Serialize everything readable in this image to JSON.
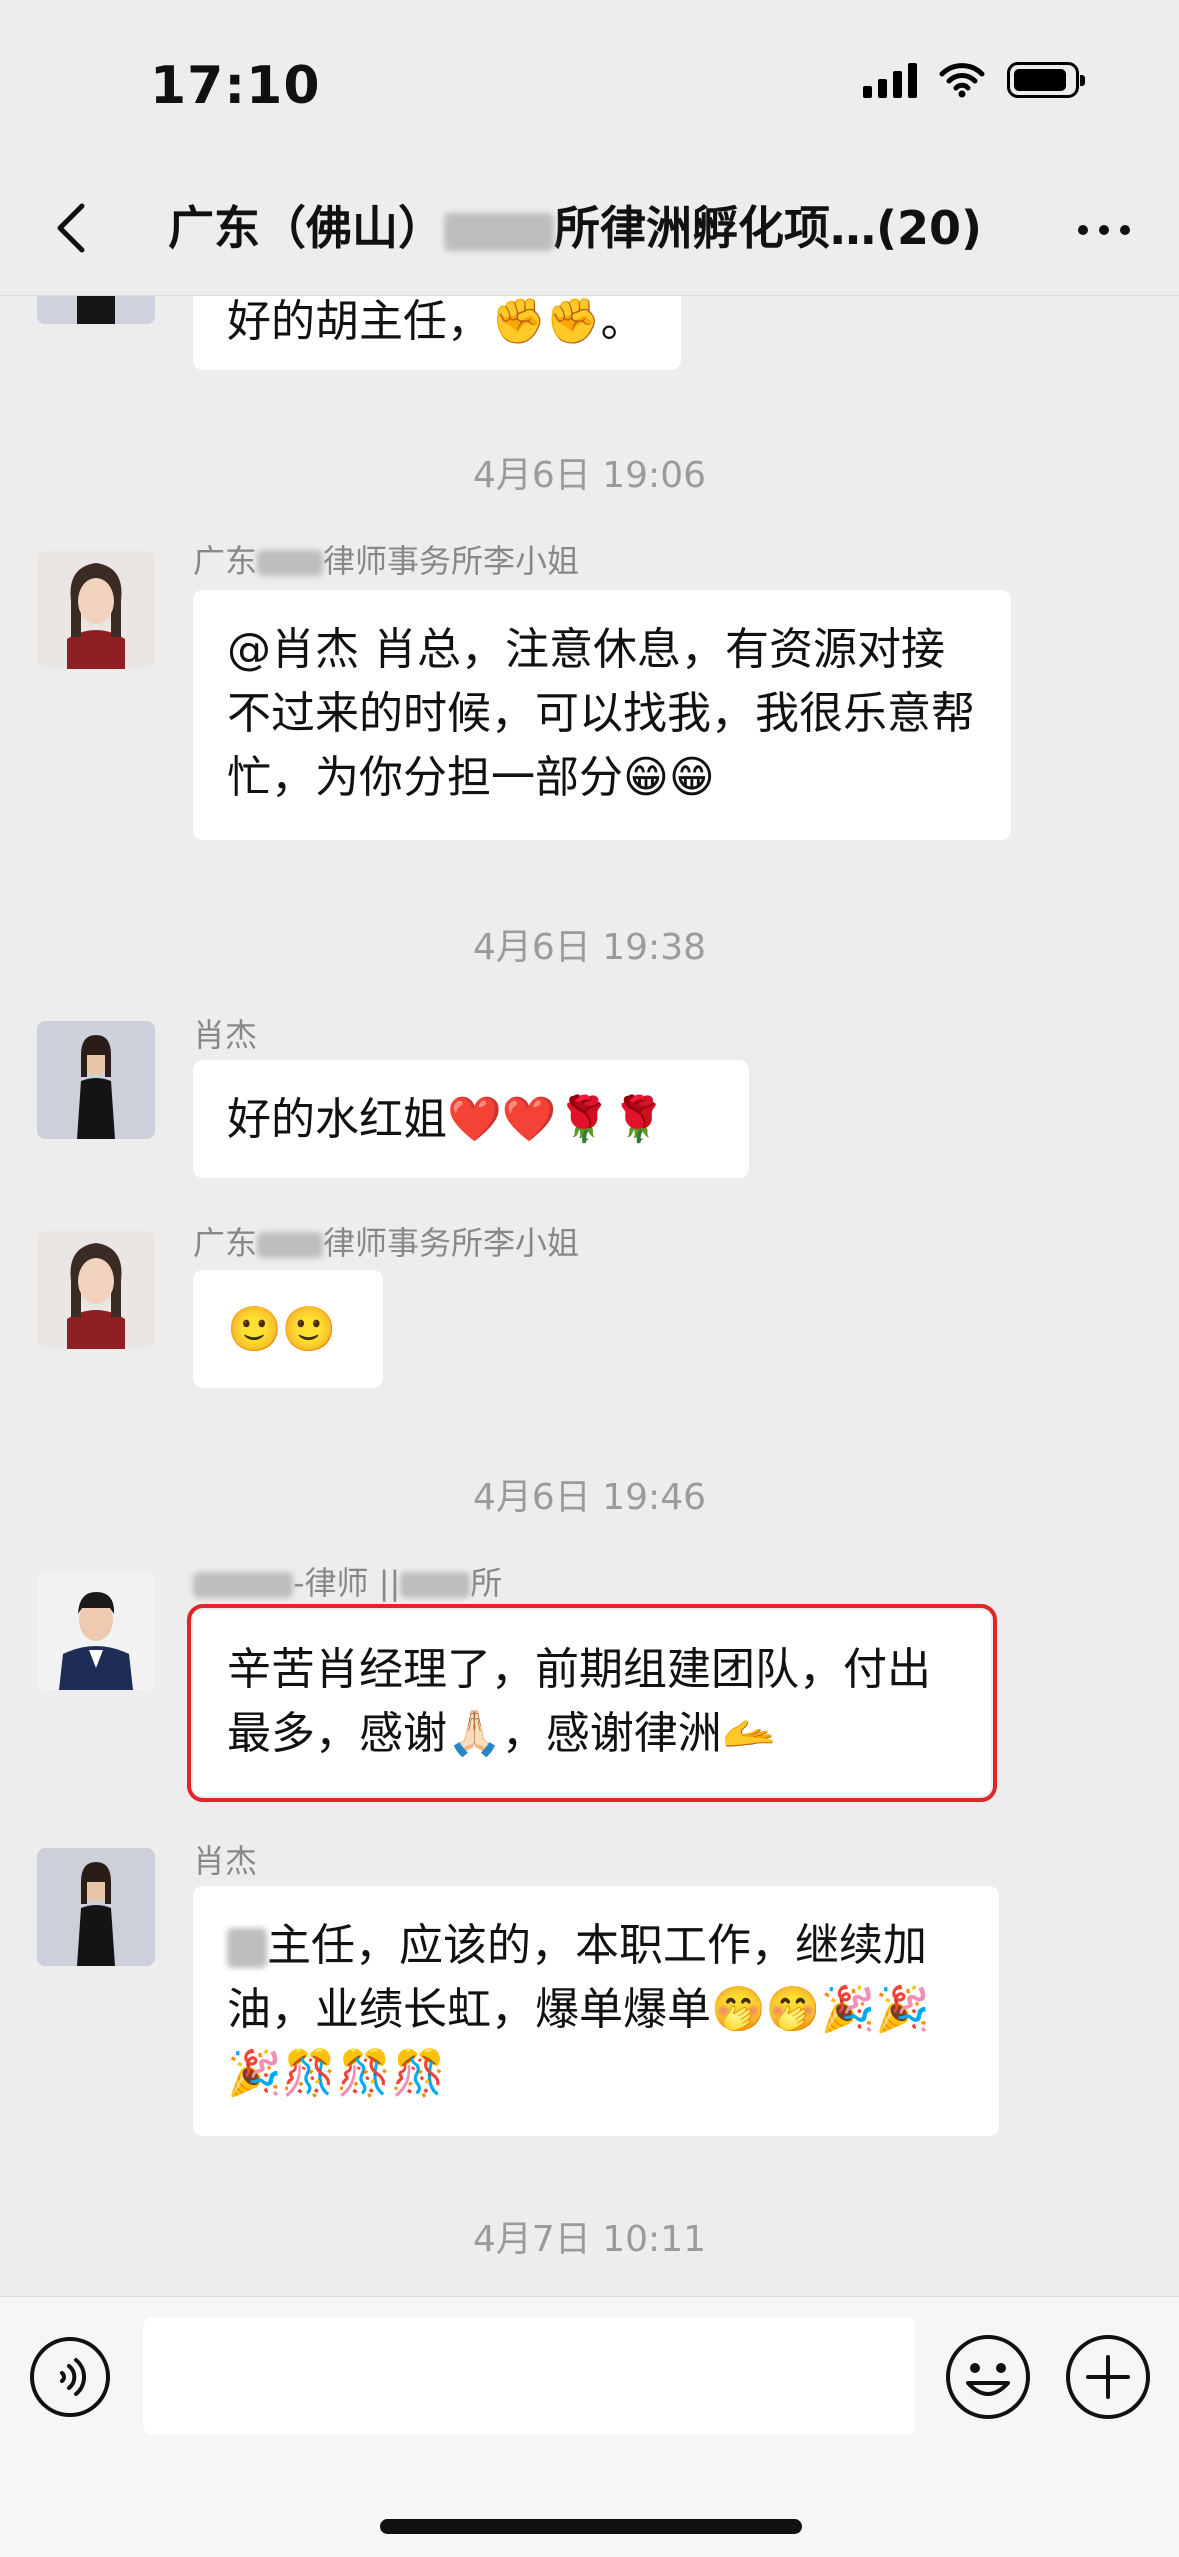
{
  "status_bar": {
    "time": "17:10"
  },
  "header": {
    "title_prefix": "广东（佛山）",
    "title_suffix": "所律洲孵化项…",
    "member_count": "(20)"
  },
  "messages": {
    "m0": {
      "text": "好的胡主任，✊✊。"
    },
    "ts1": "4月6日 19:06",
    "m1": {
      "sender_prefix": "广东",
      "sender_suffix": "律师事务所李小姐",
      "text": "@肖杰 肖总，注意休息，有资源对接不过来的时候，可以找我，我很乐意帮忙，为你分担一部分😁😁"
    },
    "ts2": "4月6日 19:38",
    "m2": {
      "sender": "肖杰",
      "text": "好的水红姐❤️❤️🌹🌹"
    },
    "m3": {
      "sender_prefix": "广东",
      "sender_suffix": "律师事务所李小姐",
      "text": "🙂🙂"
    },
    "ts3": "4月6日 19:46",
    "m4": {
      "sender_mid": "-律师 ||",
      "sender_suffix": "所",
      "text": "辛苦肖经理了，前期组建团队，付出最多，感谢🙏🏻，感谢律洲🫴"
    },
    "m5": {
      "sender": "肖杰",
      "text": "主任，应该的，本职工作，继续加油，业绩长虹，爆单爆单🤭🤭🎉🎉🎉🎊🎊🎊"
    },
    "ts4": "4月7日 10:11"
  },
  "input_bar": {
    "placeholder": ""
  },
  "colors": {
    "background": "#ededed",
    "bubble": "#ffffff",
    "highlight": "#e02626"
  }
}
